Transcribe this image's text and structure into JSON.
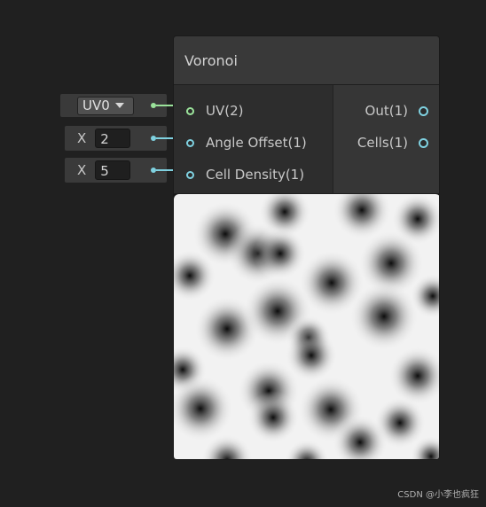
{
  "node": {
    "title": "Voronoi",
    "inputs": [
      {
        "label": "UV(2)"
      },
      {
        "label": "Angle Offset(1)"
      },
      {
        "label": "Cell Density(1)"
      }
    ],
    "outputs": [
      {
        "label": "Out(1)"
      },
      {
        "label": "Cells(1)"
      }
    ]
  },
  "external_inputs": {
    "uv_dropdown": {
      "value": "UV0"
    },
    "angle_offset": {
      "axis": "X",
      "value": "2"
    },
    "cell_density": {
      "axis": "X",
      "value": "5"
    }
  },
  "colors": {
    "uv_port": "#9be39b",
    "float_port": "#7fd1e0",
    "background": "#202020"
  },
  "watermark": "CSDN @小李也疯狂"
}
